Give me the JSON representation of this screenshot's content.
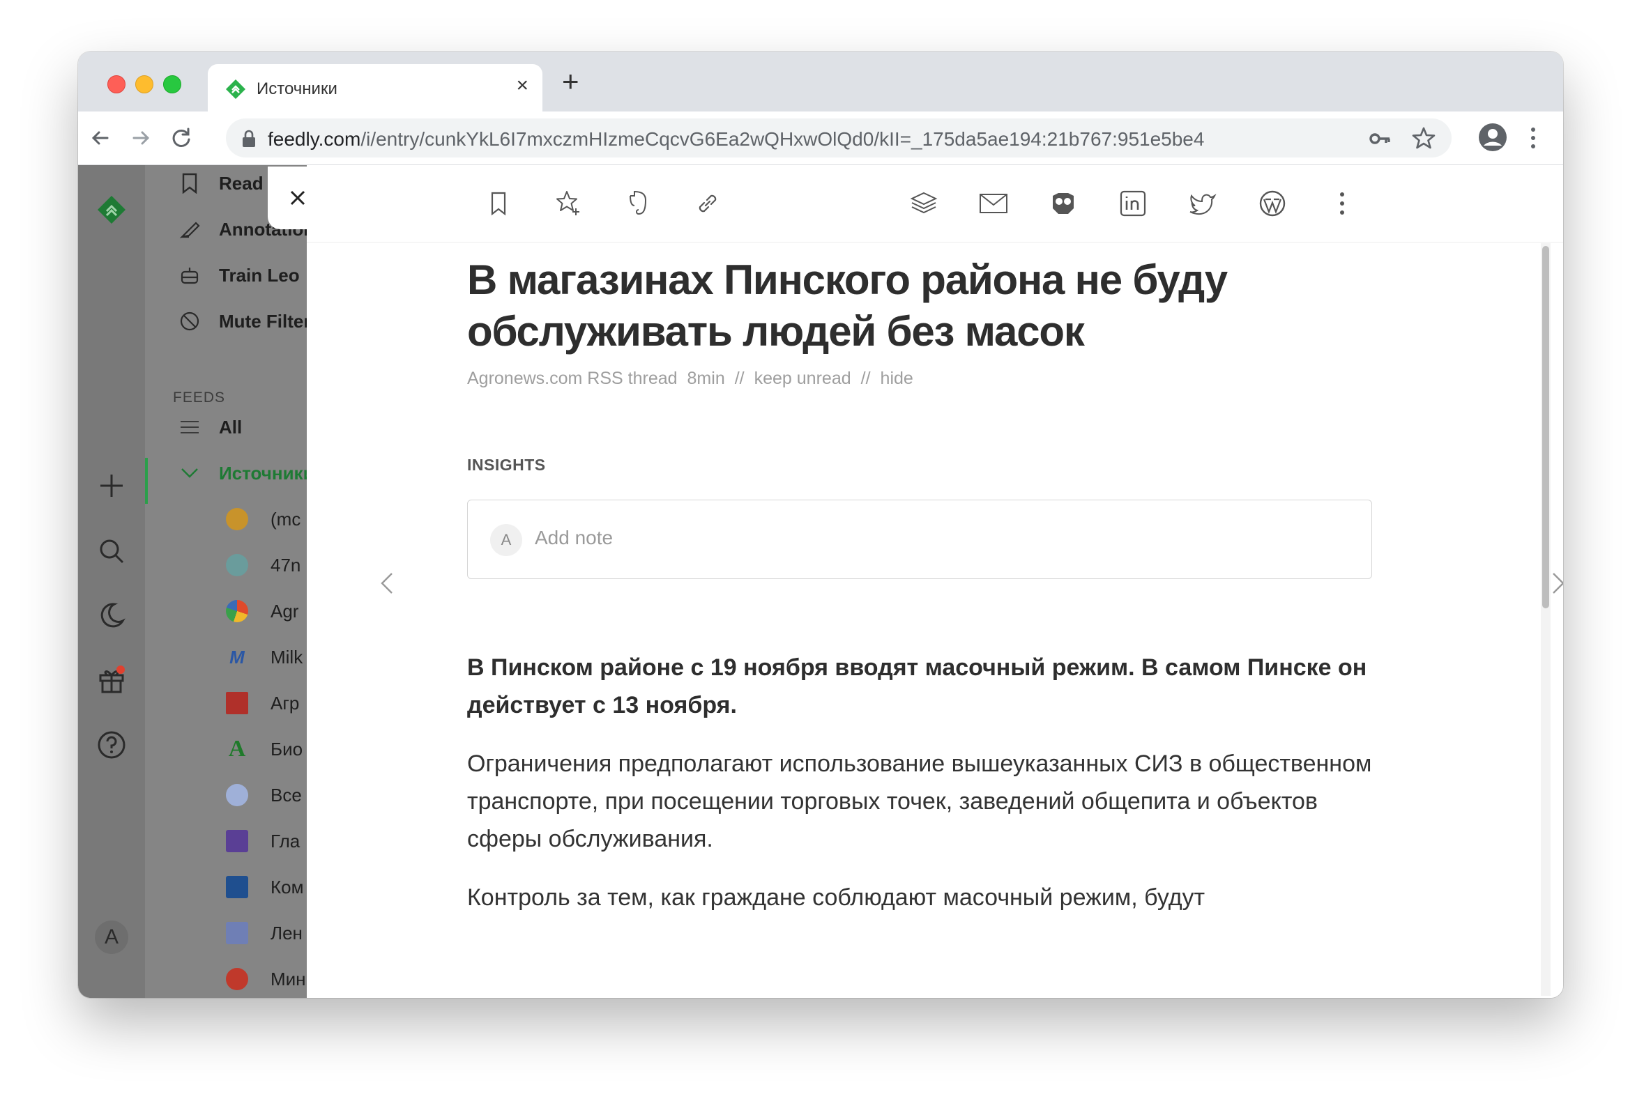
{
  "browser": {
    "tab_title": "Источники",
    "url_host": "feedly.com",
    "url_path": "/i/entry/cunkYkL6I7mxczmHIzmeCqcvG6Ea2wQHxwOlQd0/kII=_175da5ae194:21b767:951e5be4"
  },
  "sidebar": {
    "top_items": [
      {
        "label": "Read Later",
        "icon": "bookmark-icon"
      },
      {
        "label": "Annotations",
        "icon": "highlighter-icon"
      },
      {
        "label": "Train Leo",
        "icon": "robot-icon"
      },
      {
        "label": "Mute Filters",
        "icon": "mute-icon"
      }
    ],
    "feeds_section": "FEEDS",
    "all_label": "All",
    "folder_label": "Источники",
    "feeds": [
      {
        "label": "(mc",
        "color": "#c8932b"
      },
      {
        "label": "47n",
        "color": "#6a9c9c"
      },
      {
        "label": "Agr",
        "color": "#4a9a3a"
      },
      {
        "label": "Milk",
        "color": "#3a6bb5"
      },
      {
        "label": "Агр",
        "color": "#c0392b"
      },
      {
        "label": "Био",
        "color": "#2a8a2a"
      },
      {
        "label": "Все",
        "color": "#7a9ad0"
      },
      {
        "label": "Гла",
        "color": "#6a4fa0"
      },
      {
        "label": "Ком",
        "color": "#1f4f8f"
      },
      {
        "label": "Лен",
        "color": "#6f7fb5"
      },
      {
        "label": "Мин",
        "color": "#c0392b"
      }
    ],
    "avatar_letter": "A"
  },
  "article": {
    "title": "В магазинах Пинского района не буду обслуживать людей без масок",
    "source": "Agronews.com RSS thread",
    "read_time": "8min",
    "sep1": "//",
    "keep_unread": "keep unread",
    "sep2": "//",
    "hide": "hide",
    "insights_label": "INSIGHTS",
    "note_avatar": "A",
    "note_placeholder": "Add note",
    "lead": "В Пинском районе с 19 ноября вводят масочный режим. В самом Пинске он действует с 13 ноября.",
    "paragraph1": "Ограничения предполагают использование вышеуказанных СИЗ в общественном транспорте, при посещении торговых точек, заведений общепита и объектов сферы обслуживания.",
    "paragraph2": "Контроль за тем, как граждане соблюдают масочный режим, будут"
  },
  "colors": {
    "feedly_green": "#2bb24c",
    "active_green": "#2b9f4a"
  }
}
